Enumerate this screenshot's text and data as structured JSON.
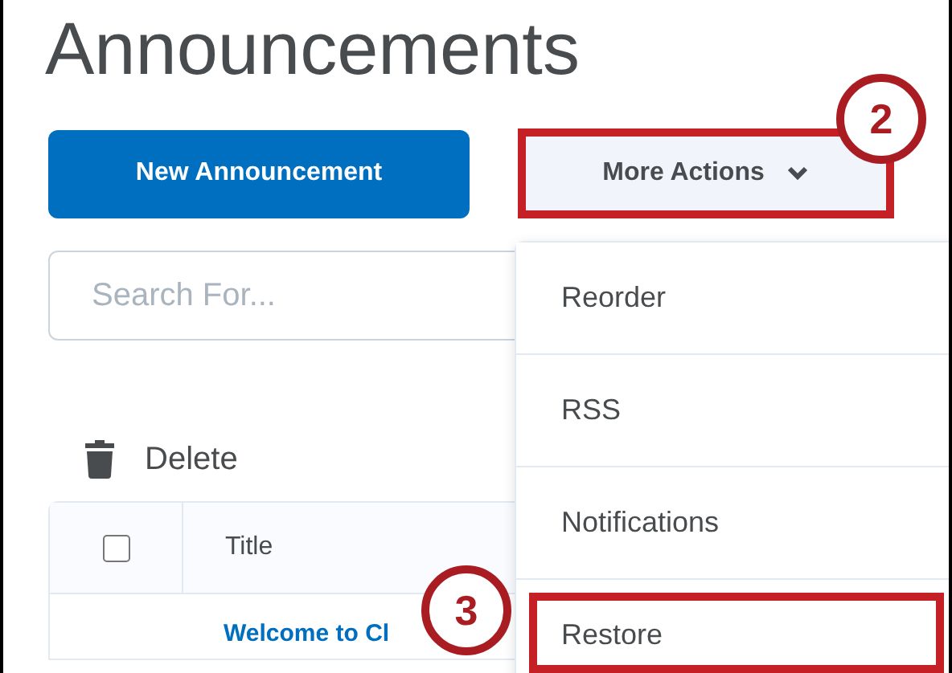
{
  "title": "Announcements",
  "new_button": "New Announcement",
  "more_actions": {
    "label": "More Actions",
    "expanded": true,
    "highlighted": true,
    "step": "2"
  },
  "search": {
    "placeholder": "Search For..."
  },
  "delete": "Delete",
  "table": {
    "columns": [
      {
        "kind": "checkbox",
        "checked": false
      },
      {
        "kind": "text",
        "label": "Title"
      }
    ],
    "rows": [
      {
        "title": "Welcome to Cl"
      }
    ]
  },
  "menu": [
    {
      "label": "Reorder",
      "highlighted": false
    },
    {
      "label": "RSS",
      "highlighted": false
    },
    {
      "label": "Notifications",
      "highlighted": false
    },
    {
      "label": "Restore",
      "highlighted": true,
      "step": "3"
    }
  ]
}
